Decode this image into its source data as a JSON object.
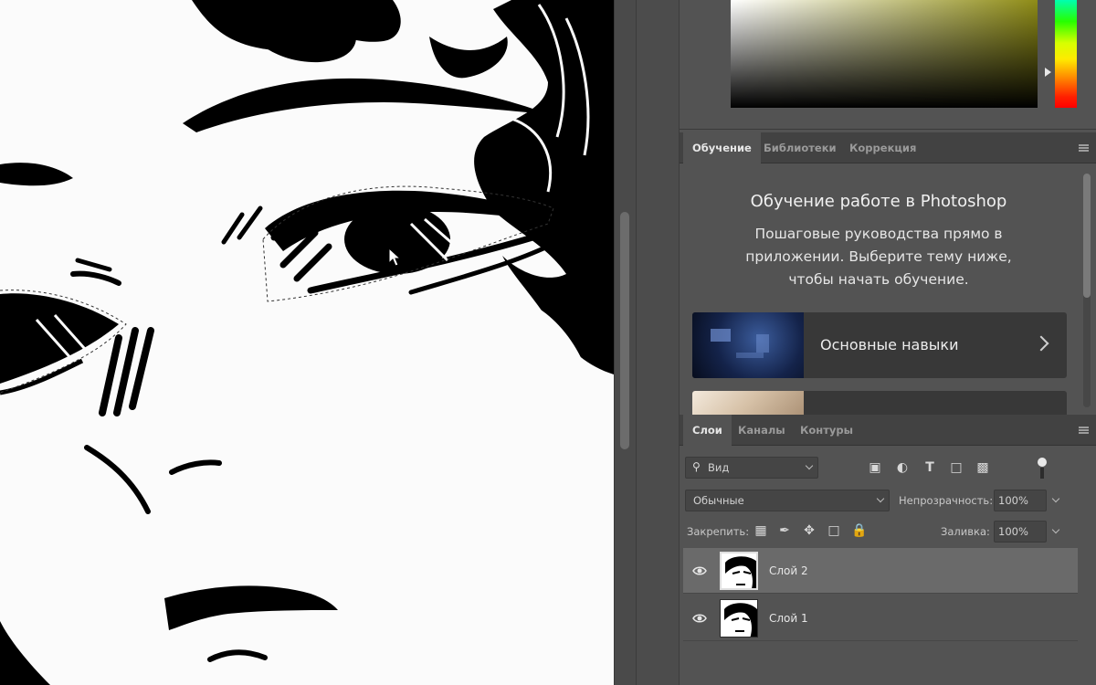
{
  "colors": {
    "panel_bg": "#535353",
    "tab_bar_bg": "#424242",
    "canvas_bg": "#fbfbfb",
    "selected_layer_bg": "#6a6a6a"
  },
  "learn_tabs": [
    {
      "label": "Обучение",
      "active": true
    },
    {
      "label": "Библиотеки",
      "active": false
    },
    {
      "label": "Коррекция",
      "active": false
    }
  ],
  "learn": {
    "title": "Обучение работе в Photoshop",
    "description": "Пошаговые руководства прямо в приложении. Выберите тему ниже, чтобы начать обучение.",
    "courses": [
      {
        "label": "Основные навыки",
        "icon": "chevron-right-icon"
      }
    ]
  },
  "layers_tabs": [
    {
      "label": "Слои",
      "active": true
    },
    {
      "label": "Каналы",
      "active": false
    },
    {
      "label": "Контуры",
      "active": false
    }
  ],
  "layers": {
    "filter_label": "Вид",
    "blend_mode": "Обычные",
    "opacity_label": "Непрозрачность:",
    "opacity_value": "100%",
    "lock_label": "Закрепить:",
    "fill_label": "Заливка:",
    "fill_value": "100%",
    "items": [
      {
        "name": "Слой 2",
        "selected": true,
        "visible": true
      },
      {
        "name": "Слой 1",
        "selected": false,
        "visible": true
      }
    ]
  }
}
